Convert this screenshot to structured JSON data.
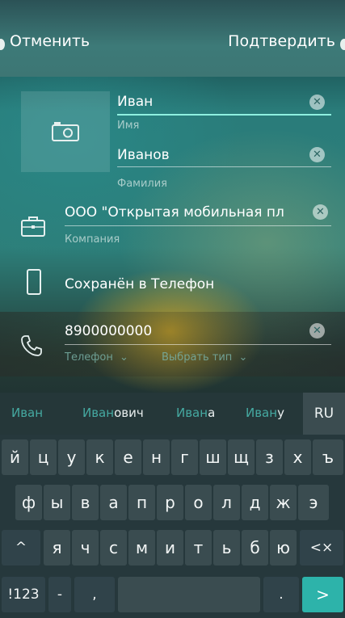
{
  "topbar": {
    "cancel_label": "Отменить",
    "confirm_label": "Подтвердить"
  },
  "contact": {
    "first_name": {
      "value": "Иван",
      "label": "Имя"
    },
    "last_name": {
      "value": "Иванов",
      "label": "Фамилия"
    },
    "company": {
      "value": "ООО \"Открытая мобильная пл",
      "label": "Компания"
    },
    "saved_in": "Сохранён в  Телефон",
    "phone": {
      "value": "8900000000",
      "label": "Телефон",
      "type_label": "Выбрать тип"
    }
  },
  "suggestions": [
    {
      "highlight": "Иван",
      "rest": ""
    },
    {
      "highlight": "Иван",
      "rest": "ович"
    },
    {
      "highlight": "Иван",
      "rest": "а"
    },
    {
      "highlight": "Иван",
      "rest": "у"
    }
  ],
  "keyboard": {
    "language": "RU",
    "row1": [
      "й",
      "ц",
      "у",
      "к",
      "е",
      "н",
      "г",
      "ш",
      "щ",
      "з",
      "х",
      "ъ"
    ],
    "row2": [
      "ф",
      "ы",
      "в",
      "а",
      "п",
      "р",
      "о",
      "л",
      "д",
      "ж",
      "э"
    ],
    "row3": [
      "я",
      "ч",
      "с",
      "м",
      "и",
      "т",
      "ь",
      "б",
      "ю"
    ],
    "shift": "^",
    "backspace": "<×",
    "numbers": "!123",
    "dash": "-",
    "comma": ",",
    "period": ".",
    "enter": ">"
  },
  "colors": {
    "accent": "#2db3aa",
    "suggestion_highlight": "#45a9a1"
  }
}
